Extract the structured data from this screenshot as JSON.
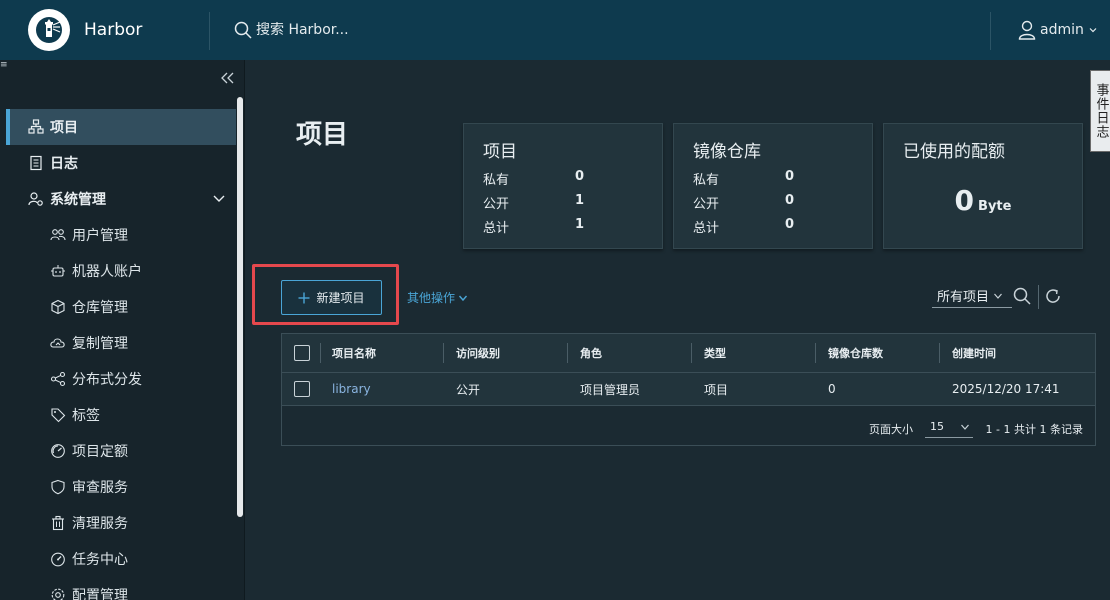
{
  "header": {
    "brand": "Harbor",
    "search_placeholder": "搜索 Harbor...",
    "user": "admin"
  },
  "sidebar": {
    "items": [
      {
        "label": "项目",
        "icon": "projects-icon",
        "active": true
      },
      {
        "label": "日志",
        "icon": "logs-icon"
      },
      {
        "label": "系统管理",
        "icon": "admin-icon",
        "expandable": true
      }
    ],
    "sub_items": [
      {
        "label": "用户管理",
        "icon": "users-icon"
      },
      {
        "label": "机器人账户",
        "icon": "robot-icon"
      },
      {
        "label": "仓库管理",
        "icon": "registry-icon"
      },
      {
        "label": "复制管理",
        "icon": "replication-icon"
      },
      {
        "label": "分布式分发",
        "icon": "distribution-icon"
      },
      {
        "label": "标签",
        "icon": "tag-icon"
      },
      {
        "label": "项目定额",
        "icon": "quota-icon"
      },
      {
        "label": "审查服务",
        "icon": "shield-icon"
      },
      {
        "label": "清理服务",
        "icon": "trash-icon"
      },
      {
        "label": "任务中心",
        "icon": "dashboard-icon"
      },
      {
        "label": "配置管理",
        "icon": "gear-icon"
      }
    ]
  },
  "main": {
    "title": "项目",
    "cards": {
      "projects": {
        "title": "项目",
        "rows": [
          {
            "label": "私有",
            "value": "0"
          },
          {
            "label": "公开",
            "value": "1"
          },
          {
            "label": "总计",
            "value": "1"
          }
        ]
      },
      "repos": {
        "title": "镜像仓库",
        "rows": [
          {
            "label": "私有",
            "value": "0"
          },
          {
            "label": "公开",
            "value": "0"
          },
          {
            "label": "总计",
            "value": "0"
          }
        ]
      },
      "quota": {
        "title": "已使用的配额",
        "value": "0",
        "unit": "Byte"
      }
    },
    "toolbar": {
      "new_project": "新建项目",
      "more_actions": "其他操作",
      "filter_value": "所有项目"
    },
    "table": {
      "columns": [
        "项目名称",
        "访问级别",
        "角色",
        "类型",
        "镜像仓库数",
        "创建时间"
      ],
      "rows": [
        {
          "name": "library",
          "access": "公开",
          "role": "项目管理员",
          "type": "项目",
          "repo_count": "0",
          "created": "2025/12/20 17:41"
        }
      ],
      "footer": {
        "page_size_label": "页面大小",
        "page_size": "15",
        "count_text": "1 - 1 共计 1 条记录"
      }
    }
  },
  "event_tab": "事件日志",
  "colors": {
    "accent": "#4aa5d6",
    "header_bg": "#0e3a4e",
    "highlight": "#e5484d"
  }
}
